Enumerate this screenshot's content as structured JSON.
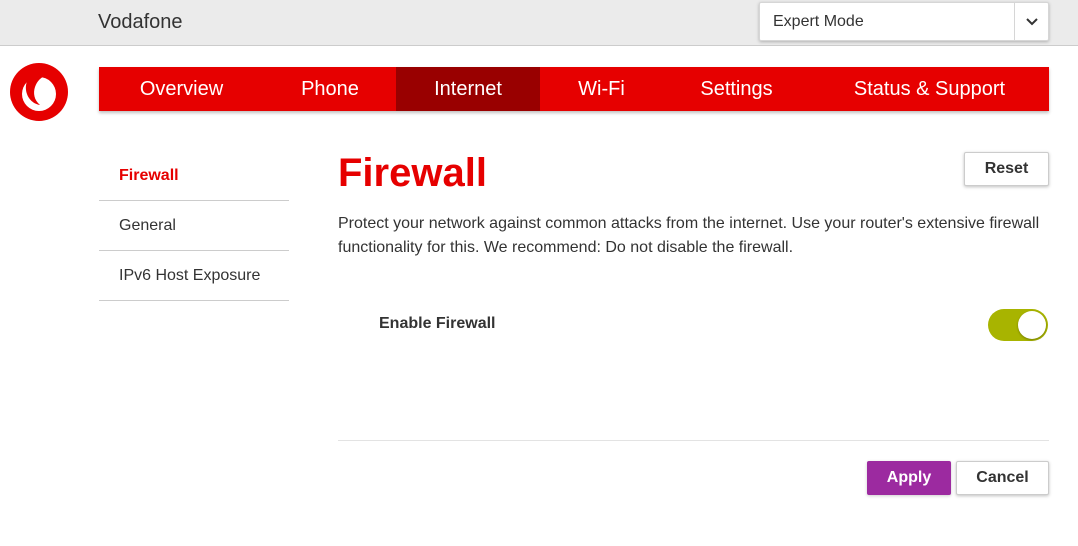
{
  "header": {
    "brand": "Vodafone",
    "mode_select": {
      "value": "Expert Mode",
      "icon": "chevron-down-icon"
    }
  },
  "logo": {
    "icon": "vodafone-speechmark-logo",
    "color": "#e60000"
  },
  "main_nav": {
    "items": [
      {
        "label": "Overview",
        "active": false
      },
      {
        "label": "Phone",
        "active": false
      },
      {
        "label": "Internet",
        "active": true
      },
      {
        "label": "Wi-Fi",
        "active": false
      },
      {
        "label": "Settings",
        "active": false
      },
      {
        "label": "Status & Support",
        "active": false
      }
    ]
  },
  "side_nav": {
    "items": [
      {
        "label": "Firewall",
        "active": true
      },
      {
        "label": "General",
        "active": false
      },
      {
        "label": "IPv6 Host Exposure",
        "active": false
      }
    ]
  },
  "content": {
    "title": "Firewall",
    "reset_label": "Reset",
    "description": "Protect your network against common attacks from the internet. Use your router's extensive firewall functionality for this. We recommend: Do not disable the firewall.",
    "settings": [
      {
        "label": "Enable Firewall",
        "enabled": true
      }
    ]
  },
  "actions": {
    "apply_label": "Apply",
    "cancel_label": "Cancel"
  },
  "colors": {
    "brand_red": "#e60000",
    "active_nav": "#990000",
    "toggle_on": "#a8b400",
    "apply_button": "#9c2aa0"
  }
}
